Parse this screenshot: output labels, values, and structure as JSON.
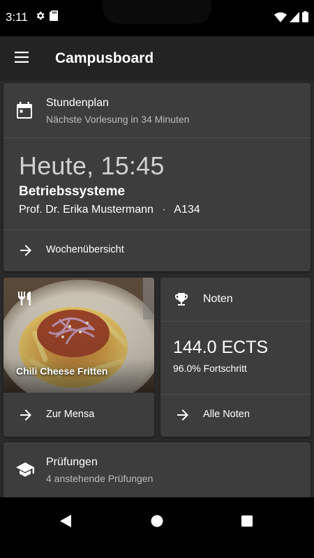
{
  "status_bar": {
    "time": "3:11",
    "left_icons": [
      "settings-gear-icon",
      "sd-card-icon"
    ],
    "right_icons": [
      "wifi-icon",
      "cellular-signal-icon",
      "battery-icon"
    ]
  },
  "app_bar": {
    "title": "Campusboard",
    "menu_icon": "hamburger-menu-icon"
  },
  "timetable": {
    "title": "Stundenplan",
    "subtitle": "Nächste Vorlesung in 34 Minuten",
    "time": "Heute, 15:45",
    "lecture": "Betriebssysteme",
    "lecturer": "Prof. Dr. Erika Mustermann",
    "separator": "·",
    "room": "A134",
    "action_label": "Wochenübersicht"
  },
  "mensa": {
    "dish": "Chili Cheese Fritten",
    "action_label": "Zur Mensa"
  },
  "grades": {
    "title": "Noten",
    "ects": "144.0 ECTS",
    "progress": "96.0% Fortschritt",
    "progress_value": 0.96,
    "action_label": "Alle Noten"
  },
  "exams": {
    "title": "Prüfungen",
    "subtitle": "4 anstehende Prüfungen"
  },
  "colors": {
    "background": "#2a2a2a",
    "card": "#3d3d3d",
    "appbar": "#232323",
    "text": "#ffffff",
    "secondary_text": "#bdbdbd"
  }
}
